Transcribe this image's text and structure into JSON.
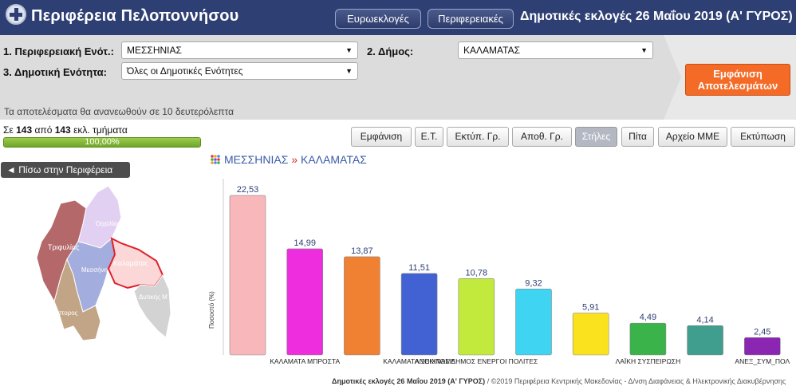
{
  "header": {
    "title": "Περιφέρεια Πελοποννήσου",
    "btn_euro": "Ευρωεκλογές",
    "btn_regional": "Περιφερειακές",
    "subtitle": "Δημοτικές εκλογές 26 Μαΐου 2019 (Α' ΓΥΡΟΣ)"
  },
  "filters": {
    "unit_label": "1. Περιφερειακή Ενότ.:",
    "unit_value": "ΜΕΣΣΗΝΙΑΣ",
    "municipality_label": "2. Δήμος:",
    "municipality_value": "ΚΑΛΑΜΑΤΑΣ",
    "community_label": "3. Δημοτική Ενότητα:",
    "community_value": "Όλες οι Δημοτικές Ενότητες",
    "show_results_line1": "Εμφάνιση",
    "show_results_line2": "Αποτελεσμάτων",
    "refresh_note": "Τα αποτελέσματα θα ανανεωθούν σε 10 δευτερόλεπτα"
  },
  "progress": {
    "prefix": "Σε ",
    "counted": "143",
    "middle": " από ",
    "total": "143",
    "suffix": " εκλ. τμήματα",
    "percent_label": "100,00%",
    "fraction": 1.0
  },
  "tabs": [
    "Εμφάνιση",
    "Ε.Τ.",
    "Εκτύπ. Γρ.",
    "Αποθ. Γρ.",
    "Στήλες",
    "Πίτα",
    "Αρχείο ΜΜΕ",
    "Εκτύπωση"
  ],
  "active_tab": "Στήλες",
  "back_button": "◄ Πίσω στην Περιφέρεια",
  "breadcrumb": {
    "unit": "ΜΕΣΣΗΝΙΑΣ",
    "separator": "»",
    "municipality": "ΚΑΛΑΜΑΤΑΣ"
  },
  "map": {
    "labels": [
      "Τριφυλίας",
      "Οιχαλίας",
      "Μεσσήνη",
      "Καλαμάτας",
      "- Νέστορος",
      "Δυτικής Μ"
    ],
    "colors": {
      "trifylia": "#b5686a",
      "oichalia": "#e2d0f2",
      "messini": "#a4aede",
      "kalamata": "#fbd7d7",
      "kalamata_border": "#e0202a",
      "pylos": "#c2a586",
      "mani": "#d3d3d3"
    }
  },
  "chart_data": {
    "type": "bar",
    "ylabel": "Ποσοστό (%)",
    "ylim": [
      0,
      24
    ],
    "categories": [
      "",
      "ΚΑΛΑΜΑΤΑ ΜΠΡΟΣΤΑ",
      "",
      "ΚΑΛΑΜΑΤΑ ΞΕΚΙΝΑΜΕ",
      "ΑΝΟΙΧΤΟΣ ΔΗΜΟΣ ΕΝΕΡΓΟΙ ΠΟΛΙΤΕΣ",
      "",
      "",
      "ΛΑΪΚΗ ΣΥΣΠΕΙΡΩΣΗ",
      "",
      "ΑΝΕΞ_ΣΥΜ_ΠΟΛ"
    ],
    "values": [
      22.53,
      14.99,
      13.87,
      11.51,
      10.78,
      9.32,
      5.91,
      4.49,
      4.14,
      2.45
    ],
    "value_labels": [
      "22,53",
      "14,99",
      "13,87",
      "11,51",
      "10,78",
      "9,32",
      "5,91",
      "4,49",
      "4,14",
      "2,45"
    ],
    "colors": [
      "#f8b8bb",
      "#ee2dde",
      "#f08032",
      "#4262d4",
      "#c2ea3c",
      "#3ed4f2",
      "#fae21e",
      "#3ab44a",
      "#3f9e8e",
      "#8a26b2"
    ]
  },
  "footer": {
    "bold": "Δημοτικές εκλογές 26 Μαΐου 2019 (Α' ΓΥΡΟΣ)",
    "rest": " / ©2019 Περιφέρεια Κεντρικής Μακεδονίας - Δ/νση Διαφάνειας & Ηλεκτρονικής Διακυβέρνησης"
  }
}
